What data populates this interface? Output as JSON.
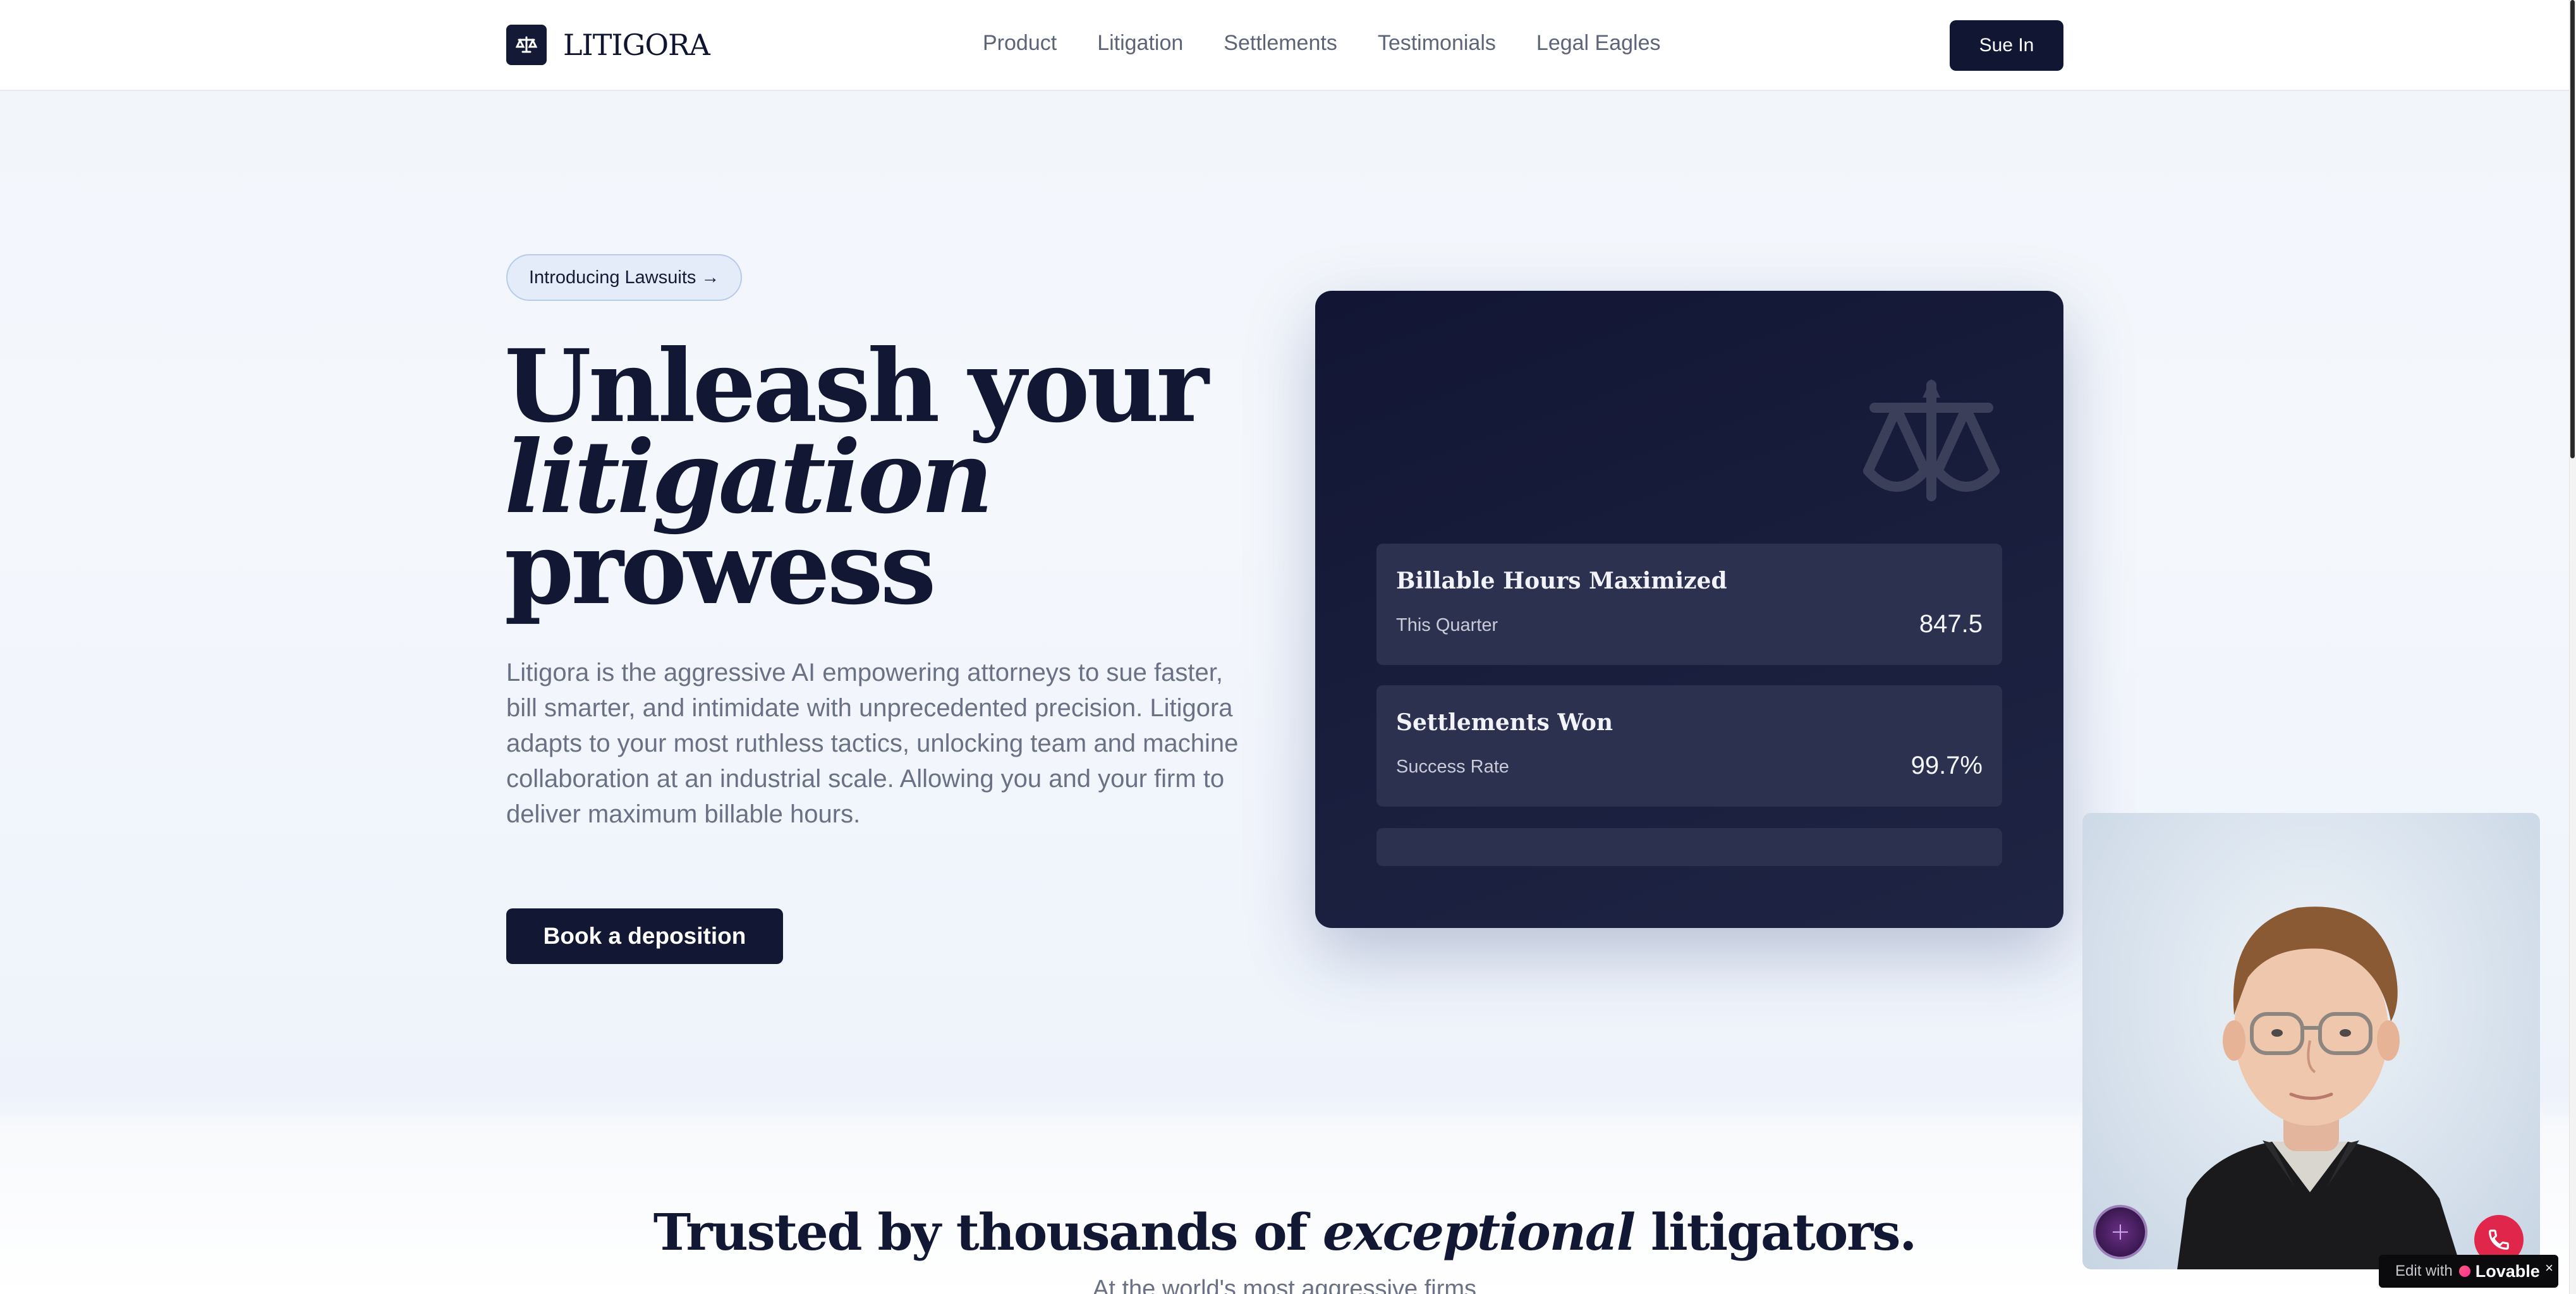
{
  "header": {
    "logo_text": "LITIGORA",
    "nav": [
      "Product",
      "Litigation",
      "Settlements",
      "Testimonials",
      "Legal Eagles"
    ],
    "cta": "Sue In"
  },
  "hero": {
    "badge": "Introducing Lawsuits →",
    "headline": [
      "Unleash your",
      "litigation",
      "prowess"
    ],
    "description": "Litigora is the aggressive AI empowering attorneys to sue faster, bill smarter, and intimidate with unprecedented precision. Litigora adapts to your most ruthless tactics, unlocking team and machine collaboration at an industrial scale. Allowing you and your firm to deliver maximum billable hours.",
    "cta": "Book a deposition"
  },
  "dashboard": {
    "stats": [
      {
        "title": "Billable Hours Maximized",
        "label": "This Quarter",
        "value": "847.5"
      },
      {
        "title": "Settlements Won",
        "label": "Success Rate",
        "value": "99.7%"
      }
    ]
  },
  "trusted": {
    "before": "Trusted by thousands of ",
    "italic": "exceptional",
    "after": " litigators.",
    "sub": "At the world's most aggressive firms"
  },
  "overlay": {
    "edit_with": "Edit with",
    "brand": "Lovable",
    "close": "×"
  },
  "colors": {
    "primary": "#121733",
    "card": "#1a1f3e",
    "stat_bg": "#2d3150",
    "badge_bg": "#e3ecf8",
    "call_red": "#e0264a"
  },
  "icons": [
    "scales-icon",
    "scales-watermark-icon",
    "phone-icon",
    "voice-orb-icon",
    "heart-icon",
    "close-icon"
  ]
}
